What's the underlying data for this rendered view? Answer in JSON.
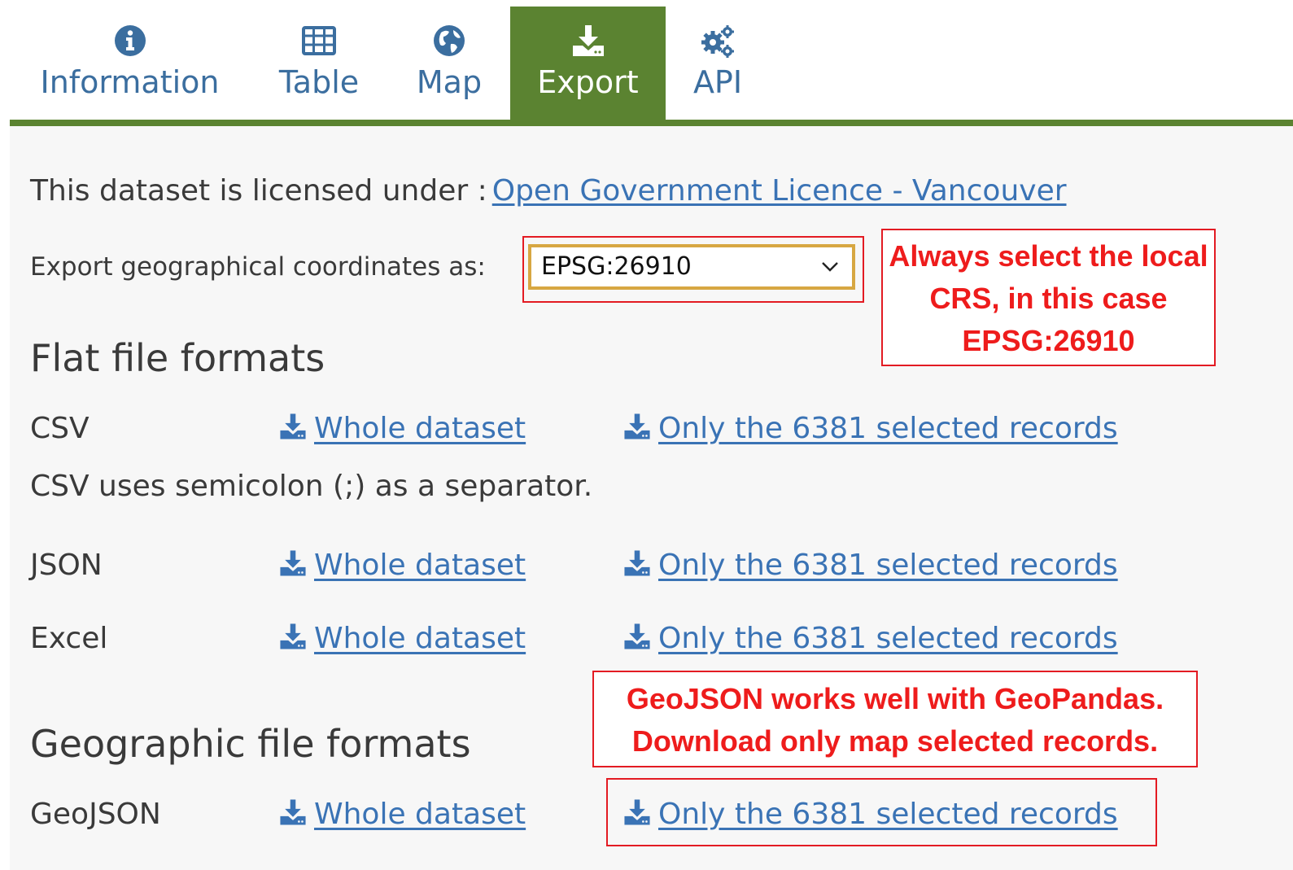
{
  "tabs": [
    {
      "label": "Information",
      "icon": "info-icon",
      "active": false
    },
    {
      "label": "Table",
      "icon": "table-icon",
      "active": false
    },
    {
      "label": "Map",
      "icon": "globe-icon",
      "active": false
    },
    {
      "label": "Export",
      "icon": "download-icon",
      "active": true
    },
    {
      "label": "API",
      "icon": "gears-icon",
      "active": false
    }
  ],
  "license": {
    "prefix": "This dataset is licensed under :",
    "link": "Open Government Licence - Vancouver"
  },
  "coordinates": {
    "label": "Export geographical coordinates as:",
    "selected": "EPSG:26910"
  },
  "notes": {
    "crs": [
      "Always select the local",
      "CRS, in this case",
      "EPSG:26910"
    ],
    "geojson": [
      "GeoJSON works well with GeoPandas.",
      "Download only map selected records."
    ]
  },
  "sections": {
    "flat": {
      "title": "Flat file formats",
      "csv_hint": "CSV uses semicolon (;) as a separator.",
      "formats": [
        {
          "name": "CSV",
          "whole": "Whole dataset",
          "selected": "Only the 6381 selected records"
        },
        {
          "name": "JSON",
          "whole": "Whole dataset",
          "selected": "Only the 6381 selected records"
        },
        {
          "name": "Excel",
          "whole": "Whole dataset",
          "selected": "Only the 6381 selected records"
        }
      ]
    },
    "geo": {
      "title": "Geographic file formats",
      "formats": [
        {
          "name": "GeoJSON",
          "whole": "Whole dataset",
          "selected": "Only the 6381 selected records"
        }
      ]
    }
  },
  "colors": {
    "accent_green": "#5b8331",
    "link_blue": "#3a73b5",
    "annotation_red": "#e31b23",
    "select_border": "#d7a742"
  }
}
